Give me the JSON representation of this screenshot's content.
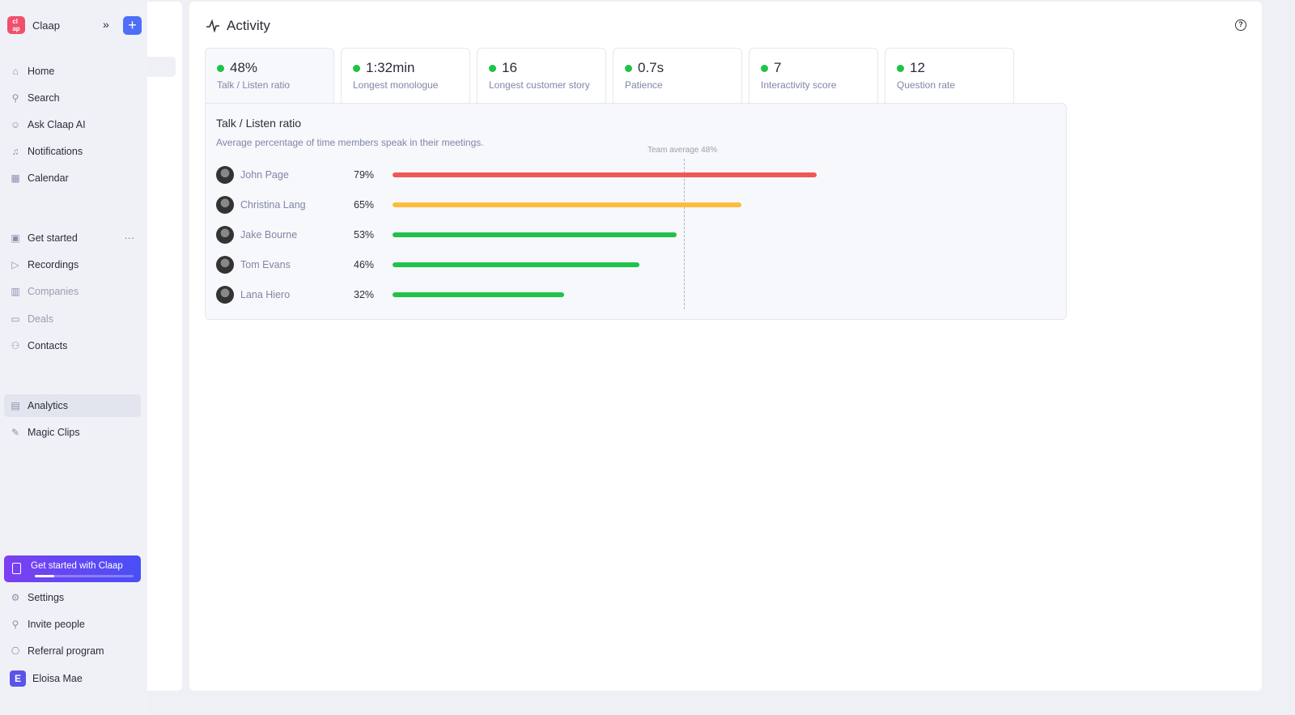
{
  "sidebar": {
    "brand": "Claap",
    "logo_text": "cla ap",
    "items": [
      {
        "label": "Home",
        "icon": "home-icon"
      },
      {
        "label": "Search",
        "icon": "search-icon"
      },
      {
        "label": "Ask Claap AI",
        "icon": "smile-icon"
      },
      {
        "label": "Notifications",
        "icon": "bell-icon"
      },
      {
        "label": "Calendar",
        "icon": "calendar-icon"
      }
    ],
    "items2": [
      {
        "label": "Get started",
        "icon": "new-icon"
      },
      {
        "label": "Recordings",
        "icon": "play-icon"
      },
      {
        "label": "Companies",
        "icon": "building-icon"
      },
      {
        "label": "Deals",
        "icon": "briefcase-icon"
      },
      {
        "label": "Contacts",
        "icon": "users-icon"
      }
    ],
    "items3": [
      {
        "label": "Analytics",
        "icon": "chart-icon"
      },
      {
        "label": "Magic Clips",
        "icon": "pen-icon"
      }
    ],
    "get_started": {
      "label": "Get started with Claap",
      "progress": 0.2
    },
    "bottom": [
      {
        "label": "Settings",
        "icon": "gear-icon"
      },
      {
        "label": "Invite people",
        "icon": "user-plus-icon"
      },
      {
        "label": "Referral program",
        "icon": "gift-icon"
      }
    ],
    "user": {
      "initial": "E",
      "name": "Eloisa Mae"
    }
  },
  "main": {
    "title": "Activity",
    "cards": [
      {
        "value": "48%",
        "label": "Talk / Listen ratio"
      },
      {
        "value": "1:32min",
        "label": "Longest monologue"
      },
      {
        "value": "16",
        "label": "Longest customer story"
      },
      {
        "value": "0.7s",
        "label": "Patience"
      },
      {
        "value": "7",
        "label": "Interactivity score"
      },
      {
        "value": "12",
        "label": "Question rate"
      }
    ]
  },
  "chart_data": {
    "type": "bar",
    "orientation": "horizontal",
    "title": "Talk / Listen ratio",
    "subtitle": "Average percentage of time members speak in their meetings.",
    "categories": [
      "John Page",
      "Christina Lang",
      "Jake Bourne",
      "Tom Evans",
      "Lana Hiero"
    ],
    "values": [
      79,
      65,
      53,
      46,
      32
    ],
    "labels": [
      "79%",
      "65%",
      "53%",
      "46%",
      "32%"
    ],
    "colors": [
      "#f25757",
      "#fbbd3c",
      "#1fc24a",
      "#1fc24a",
      "#1fc24a"
    ],
    "reference_line": {
      "label": "Team average 48%",
      "value": 48
    }
  }
}
